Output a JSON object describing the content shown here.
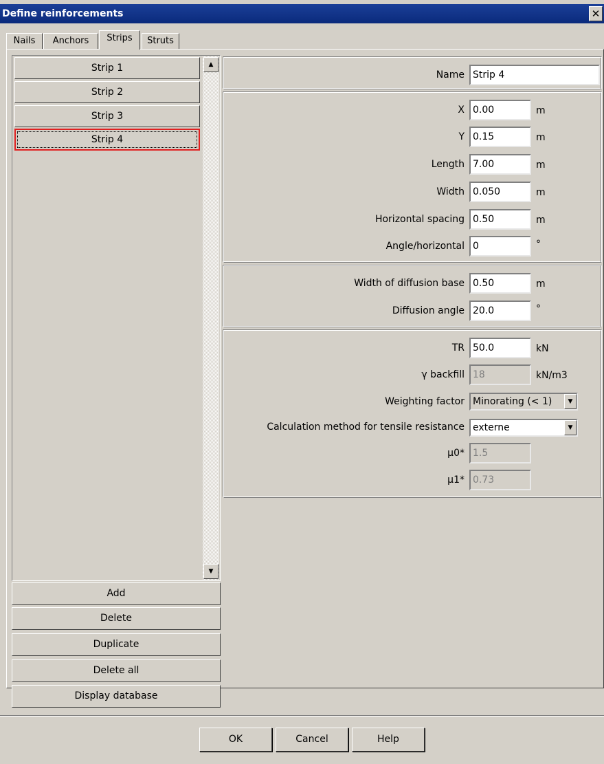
{
  "window": {
    "title": "Define reinforcements",
    "close_glyph": "✕"
  },
  "tabs": [
    {
      "label": "Nails"
    },
    {
      "label": "Anchors"
    },
    {
      "label": "Strips"
    },
    {
      "label": "Struts"
    }
  ],
  "active_tab": "Strips",
  "strips": [
    {
      "label": "Strip 1"
    },
    {
      "label": "Strip 2"
    },
    {
      "label": "Strip 3"
    },
    {
      "label": "Strip 4"
    }
  ],
  "selected_strip": "Strip 4",
  "list_buttons": {
    "add": "Add",
    "delete": "Delete",
    "duplicate": "Duplicate",
    "delete_all": "Delete all",
    "display_database": "Display database"
  },
  "form": {
    "name": {
      "label": "Name",
      "value": "Strip 4"
    },
    "geometry": {
      "x": {
        "label": "X",
        "value": "0.00",
        "unit": "m"
      },
      "y": {
        "label": "Y",
        "value": "0.15",
        "unit": "m"
      },
      "length": {
        "label": "Length",
        "value": "7.00",
        "unit": "m"
      },
      "width": {
        "label": "Width",
        "value": "0.050",
        "unit": "m"
      },
      "horizontal_spacing": {
        "label": "Horizontal spacing",
        "value": "0.50",
        "unit": "m"
      },
      "angle_horizontal": {
        "label": "Angle/horizontal",
        "value": "0",
        "unit": "°"
      }
    },
    "diffusion": {
      "base_width": {
        "label": "Width of diffusion base",
        "value": "0.50",
        "unit": "m"
      },
      "angle": {
        "label": "Diffusion angle",
        "value": "20.0",
        "unit": "°"
      }
    },
    "resistance": {
      "tr": {
        "label": "TR",
        "value": "50.0",
        "unit": "kN"
      },
      "gamma_backfill": {
        "label": "γ backfill",
        "value": "18",
        "unit": "kN/m3"
      },
      "weighting_factor": {
        "label": "Weighting factor",
        "value": "Minorating (< 1)"
      },
      "calc_method": {
        "label": "Calculation method for tensile resistance",
        "value": "externe"
      },
      "mu0": {
        "label": "μ0*",
        "value": "1.5"
      },
      "mu1": {
        "label": "μ1*",
        "value": "0.73"
      }
    }
  },
  "footer": {
    "ok": "OK",
    "cancel": "Cancel",
    "help": "Help"
  }
}
